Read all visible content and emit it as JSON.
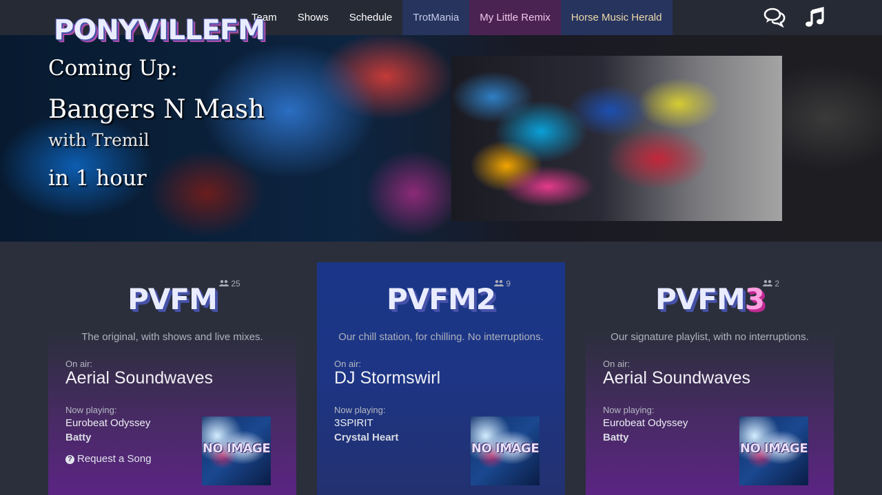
{
  "brand": {
    "logo_text": "PONYVILLEFM"
  },
  "nav": {
    "links": [
      "Team",
      "Shows",
      "Schedule",
      "TrotMania",
      "My Little Remix",
      "Horse Music Herald"
    ]
  },
  "icons": {
    "chat": "chat-bubbles-icon",
    "music": "music-note-icon",
    "listeners": "users-icon",
    "request": "question-circle-icon"
  },
  "hero": {
    "heading": "Coming Up:",
    "show_title": "Bangers N Mash",
    "host": "with Tremil",
    "countdown": "in 1 hour"
  },
  "stations": [
    {
      "logo": "PVFM",
      "logo_suffix": "",
      "listeners": "25",
      "description": "The original, with shows and live mixes.",
      "on_air_label": "On air:",
      "dj": "Aerial Soundwaves",
      "now_playing_label": "Now playing:",
      "song": "Eurobeat Odyssey",
      "artist": "Batty",
      "request_label": "Request a Song",
      "cover_text": "NO IMAGE"
    },
    {
      "logo": "PVFM",
      "logo_suffix": "2",
      "listeners": "9",
      "description": "Our chill station, for chilling. No interruptions.",
      "on_air_label": "On air:",
      "dj": "DJ Stormswirl",
      "now_playing_label": "Now playing:",
      "song": "3SPIRIT",
      "artist": "Crystal Heart",
      "cover_text": "NO IMAGE"
    },
    {
      "logo": "PVFM",
      "logo_suffix": "3",
      "listeners": "2",
      "description": "Our signature playlist, with no interruptions.",
      "on_air_label": "On air:",
      "dj": "Aerial Soundwaves",
      "now_playing_label": "Now playing:",
      "song": "Eurobeat Odyssey",
      "artist": "Batty",
      "cover_text": "NO IMAGE"
    }
  ],
  "colors": {
    "nav_bg": "#262a35",
    "page_bg": "#2b2f3c",
    "pvfm2_bg": "#1b3688",
    "purple": "#5b2483"
  }
}
